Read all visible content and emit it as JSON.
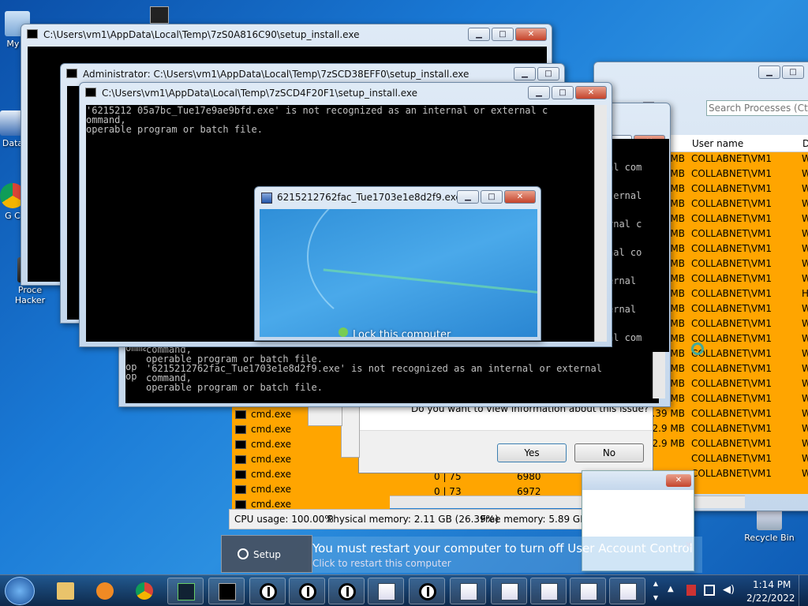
{
  "colors": {
    "accent": "#ffa500",
    "console_bg": "#000000",
    "desktop": "#1a7ad6"
  },
  "desktop_icons": [
    {
      "label": "My C",
      "icon": "computer-icon"
    },
    {
      "label": "Data",
      "icon": "data-icon"
    },
    {
      "label": "G C",
      "icon": "chrome-icon"
    },
    {
      "label": "Proce Hacker",
      "icon": "process-hacker-icon"
    },
    {
      "label": "Recycle Bin",
      "icon": "recycle-bin-icon"
    }
  ],
  "windows": {
    "win1": {
      "title": "C:\\Users\\vm1\\AppData\\Local\\Temp\\7zS0A816C90\\setup_install.exe"
    },
    "win2": {
      "title": "Administrator: C:\\Users\\vm1\\AppData\\Local\\Temp\\7zSCD38EFF0\\setup_install.exe"
    },
    "win3": {
      "title": "C:\\Users\\vm1\\AppData\\Local\\Temp\\7zSCD4F20F1\\setup_install.exe",
      "text": "'6215212 05a7bc_Tue17e9ae9bfd.exe' is not recognized as an internal or external c\nommand,\noperable program or batch file."
    },
    "win_back": {
      "text_lines": [
        "al com",
        "",
        "ternal",
        "",
        "rnal c",
        "",
        "nal co",
        "",
        "ernal",
        "",
        "ernal",
        "",
        "al com"
      ]
    },
    "win_back_lower": {
      "text": "command,\noperable program or batch file.\n'6215212762fac_Tue1703e1e8d2f9.exe' is not recognized as an internal or external\ncommand,\noperable program or batch file.",
      "left_text": "omma\n\nop\nop"
    },
    "exe_window": {
      "title": "6215212762fac_Tue1703e1e8d2f9.exe",
      "lock_text": "Lock this computer"
    }
  },
  "process_hacker": {
    "search_placeholder": "Search Processes (Ctrl",
    "col_user": "User name",
    "col_d": "D",
    "user_value": "COLLABNET\\VM1",
    "rows": [
      {
        "mem": "MB",
        "d": "W"
      },
      {
        "mem": "MB",
        "d": "W"
      },
      {
        "mem": "MB",
        "d": "W"
      },
      {
        "mem": "MB",
        "d": "W"
      },
      {
        "mem": "MB",
        "d": "W"
      },
      {
        "mem": "MB",
        "d": "W"
      },
      {
        "mem": "MB",
        "d": "W"
      },
      {
        "mem": "MB",
        "d": "W"
      },
      {
        "mem": "MB",
        "d": "W"
      },
      {
        "mem": "MB",
        "d": "H"
      },
      {
        "mem": "MB",
        "d": "W"
      },
      {
        "mem": "MB",
        "d": "W"
      },
      {
        "mem": "MB",
        "d": "W"
      },
      {
        "mem": "MB",
        "d": "W"
      },
      {
        "mem": "MB",
        "d": "W"
      },
      {
        "mem": "MB",
        "d": "W"
      },
      {
        "mem": "2.9 MB",
        "d": "W"
      },
      {
        "mem": "2.39 MB",
        "d": "W"
      },
      {
        "mem": "2.9 MB",
        "d": "W"
      },
      {
        "mem": "2.9 MB",
        "d": "W"
      },
      {
        "mem": "",
        "d": "W"
      },
      {
        "mem": "",
        "d": "W"
      }
    ],
    "cmd_rows": [
      "cmd.exe",
      "cmd.exe",
      "cmd.exe",
      "cmd.exe",
      "cmd.exe",
      "cmd.exe",
      "cmd.exe"
    ],
    "pid_rows": [
      {
        "cpu": "0 | 75",
        "pid": "6980"
      },
      {
        "cpu": "0 | 73",
        "pid": "6972"
      }
    ],
    "status": {
      "cpu": "CPU usage: 100.00%",
      "phys": "Physical memory: 2.11 GB (26.39%)",
      "free": "Free memory: 5.89 GB (7."
    }
  },
  "dialog": {
    "question": "Do you want to view information about this issue?",
    "yes": "Yes",
    "no": "No"
  },
  "uac": {
    "title": "You must restart your computer to turn off User Account Control",
    "sub": "Click to restart this computer"
  },
  "setup_popup": {
    "label": "Setup"
  },
  "taskbar": {
    "time": "1:14 PM",
    "date": "2/22/2022"
  }
}
